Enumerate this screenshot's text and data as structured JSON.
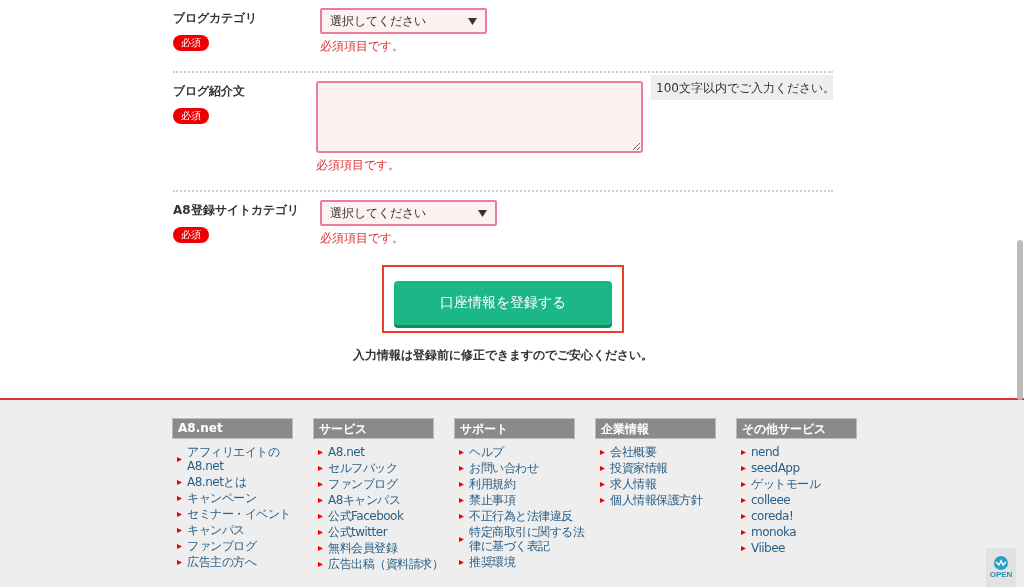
{
  "form": {
    "rows": [
      {
        "label": "ブログカテゴリ",
        "badge": "必須",
        "kind": "select",
        "value": "選択してください",
        "error": "必須項目です。"
      },
      {
        "label": "ブログ紹介文",
        "badge": "必須",
        "kind": "textarea",
        "hint": "100文字以内でご入力ください。",
        "error": "必須項目です。"
      },
      {
        "label": "A8登録サイトカテゴリ",
        "badge": "必須",
        "kind": "select",
        "value": "選択してください",
        "error": "必須項目です。"
      }
    ],
    "submit": "口座情報を登録する",
    "note": "入力情報は登録前に修正できますのでご安心ください。"
  },
  "footer": {
    "columns": [
      {
        "title": "A8.net",
        "links": [
          "アフィリエイトのA8.net",
          "A8.netとは",
          "キャンペーン",
          "セミナー・イベント",
          "キャンパス",
          "ファンブログ",
          "広告主の方へ"
        ]
      },
      {
        "title": "サービス",
        "links": [
          "A8.net",
          "セルフバック",
          "ファンブログ",
          "A8キャンパス",
          "公式Facebook",
          "公式twitter",
          "無料会員登録",
          "広告出稿（資料請求）"
        ]
      },
      {
        "title": "サポート",
        "links": [
          "ヘルプ",
          "お問い合わせ",
          "利用規約",
          "禁止事項",
          "不正行為と法律違反",
          "特定商取引に関する法律に基づく表記",
          "推奨環境"
        ]
      },
      {
        "title": "企業情報",
        "links": [
          "会社概要",
          "投資家情報",
          "求人情報",
          "個人情報保護方針"
        ]
      },
      {
        "title": "その他サービス",
        "links": [
          "nend",
          "seedApp",
          "ゲットモール",
          "colleee",
          "coreda!",
          "monoka",
          "Viibee"
        ]
      }
    ]
  },
  "widget": {
    "label": "OPEN"
  }
}
